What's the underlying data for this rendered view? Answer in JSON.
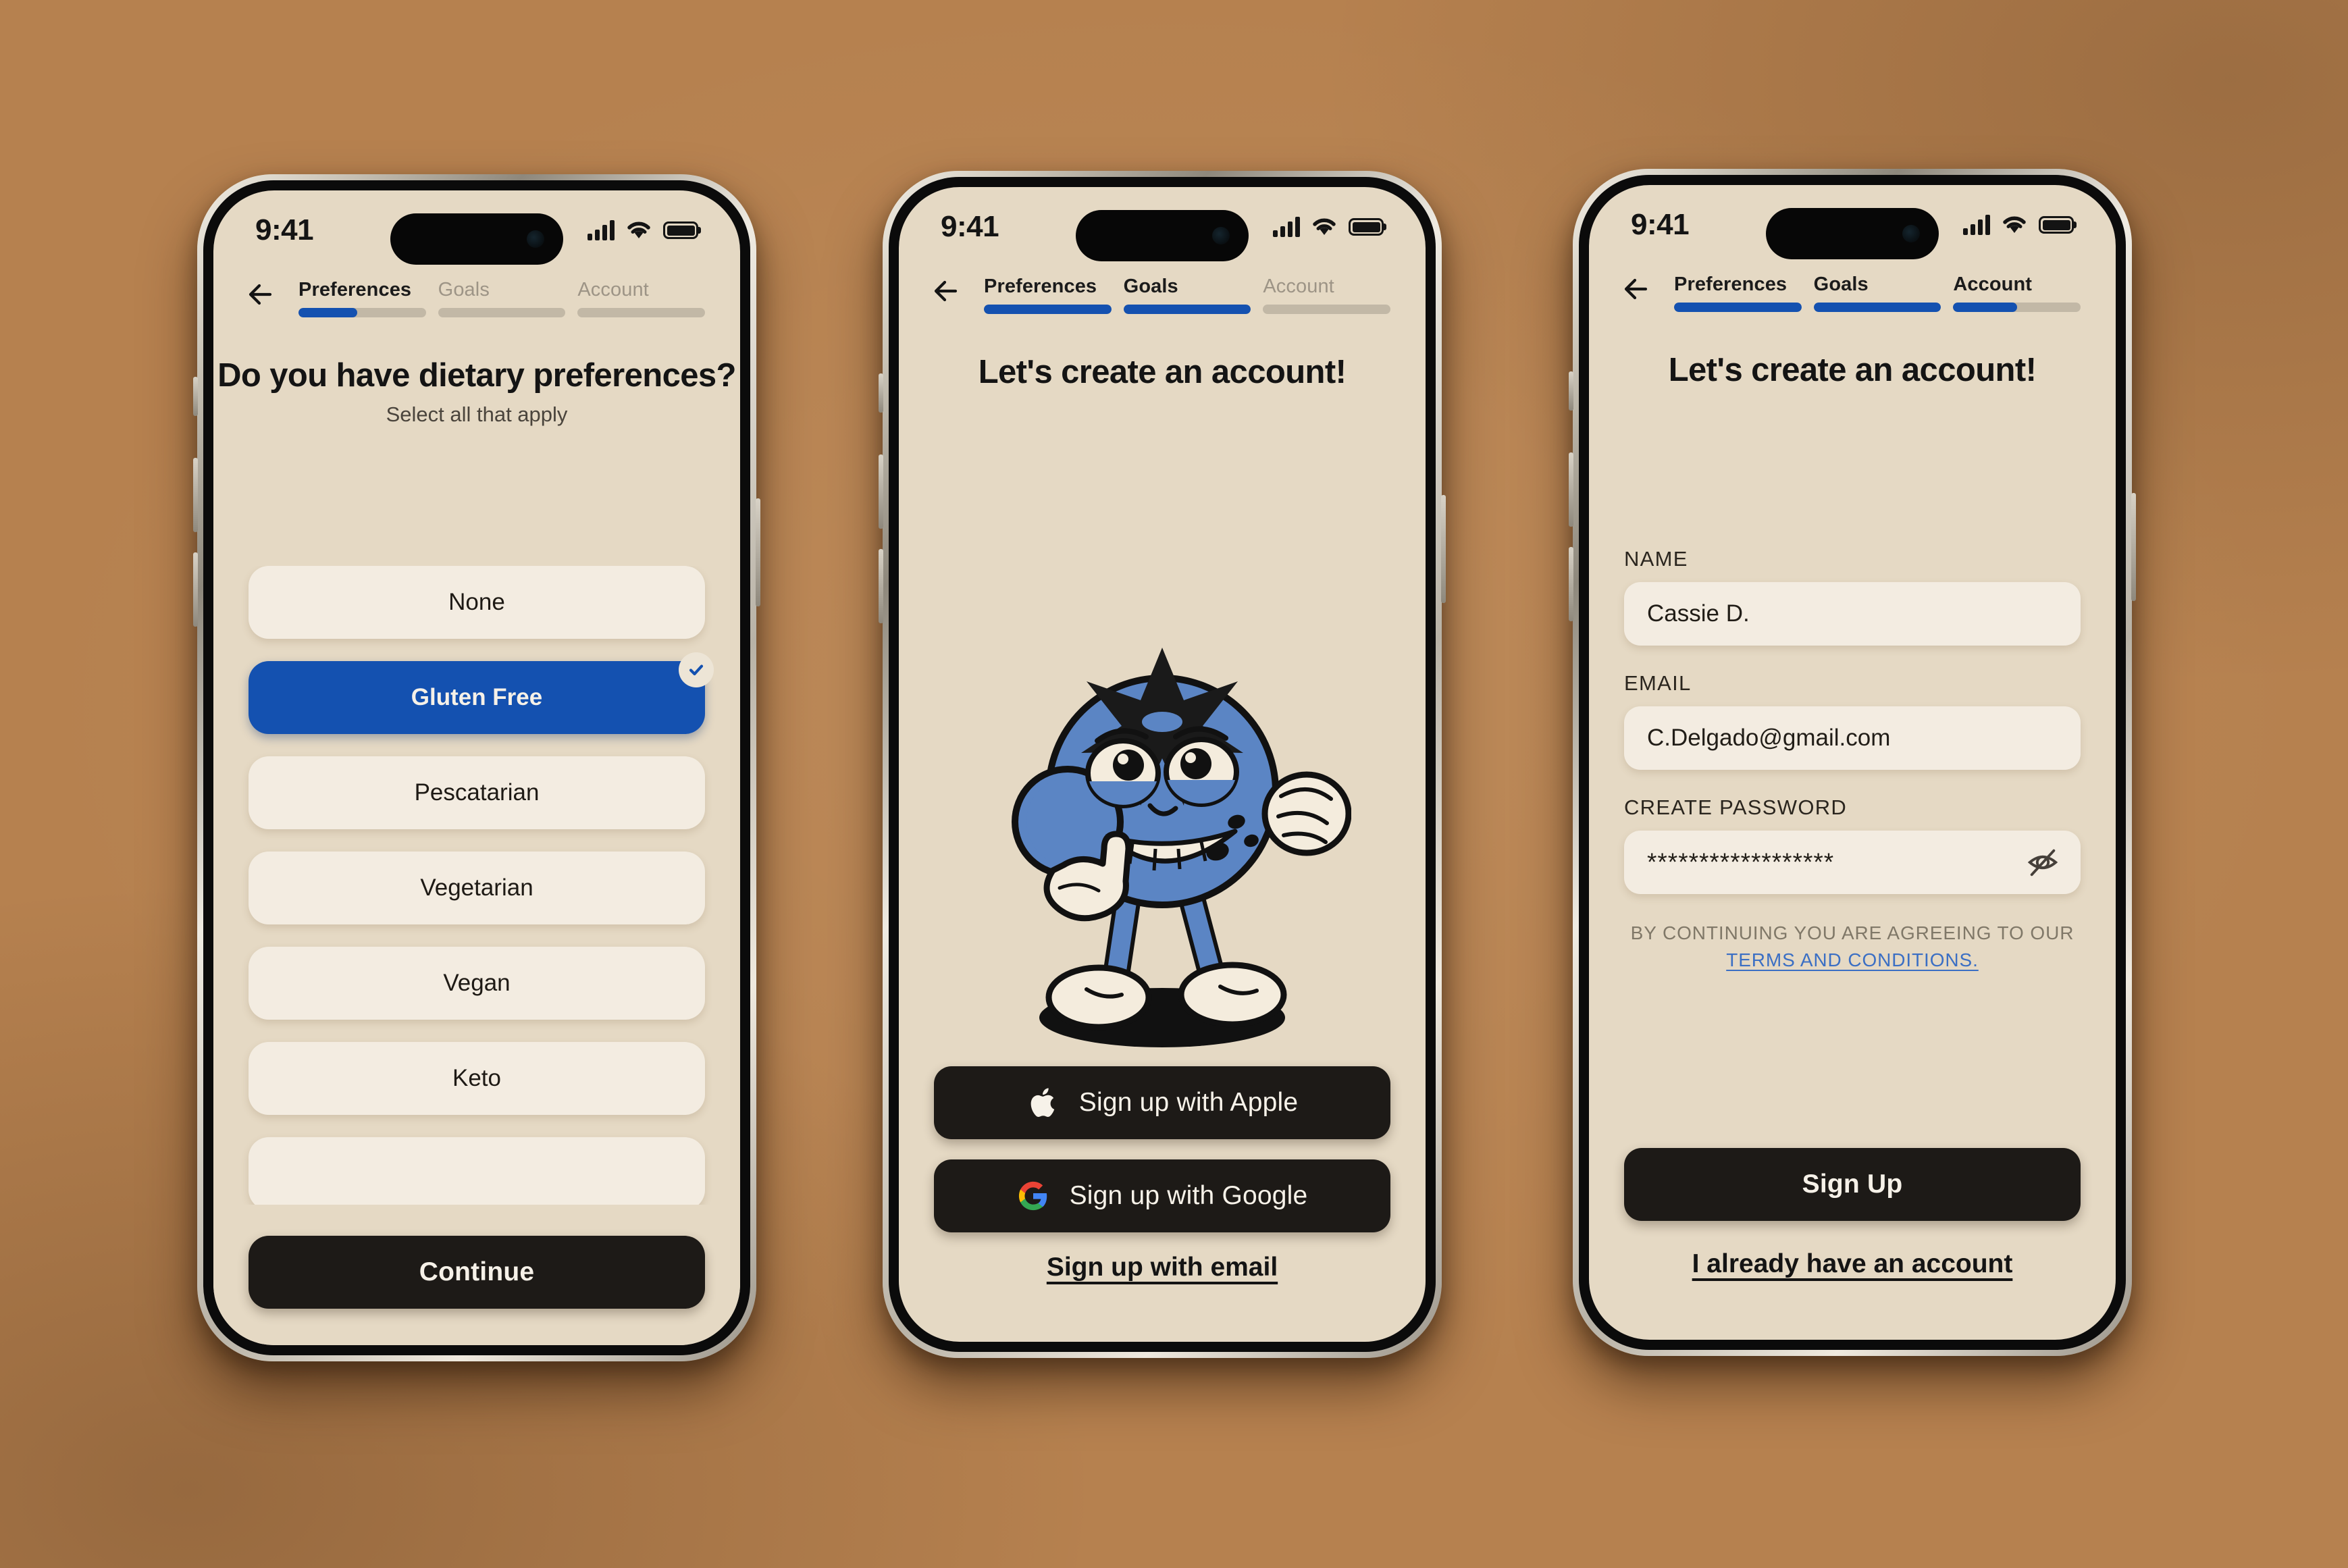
{
  "statusbar": {
    "time": "9:41",
    "signal_icon": "cellular-signal-icon",
    "wifi_icon": "wifi-icon",
    "battery_icon": "battery-full-icon"
  },
  "steps": {
    "preferences": "Preferences",
    "goals": "Goals",
    "account": "Account"
  },
  "colors": {
    "accent_blue": "#1451b0",
    "screen_bg": "#e5d9c4",
    "card_bg": "#f3ece1",
    "dark_button": "#1d1a17",
    "track_gray": "#c2b8a6",
    "link_blue": "#3b6fc4",
    "mascot_blue": "#5b85c4"
  },
  "phone1": {
    "title": "Do you have dietary preferences?",
    "subtitle": "Select all that apply",
    "progress": {
      "preferences": 46,
      "goals": 0,
      "account": 0
    },
    "options": [
      {
        "label": "None",
        "selected": false
      },
      {
        "label": "Gluten Free",
        "selected": true
      },
      {
        "label": "Pescatarian",
        "selected": false
      },
      {
        "label": "Vegetarian",
        "selected": false
      },
      {
        "label": "Vegan",
        "selected": false
      },
      {
        "label": "Keto",
        "selected": false
      }
    ],
    "continue_label": "Continue"
  },
  "phone2": {
    "title": "Let's create an account!",
    "progress": {
      "preferences": 100,
      "goals": 100,
      "account": 0
    },
    "mascot": "blueberry-mascot-illustration",
    "apple_label": "Sign up with Apple",
    "google_label": "Sign up with Google",
    "email_link": "Sign up with email"
  },
  "phone3": {
    "title": "Let's create an account!",
    "progress": {
      "preferences": 100,
      "goals": 100,
      "account": 50
    },
    "fields": {
      "name_label": "NAME",
      "name_value": "Cassie D.",
      "email_label": "EMAIL",
      "email_value": "C.Delgado@gmail.com",
      "password_label": "CREATE PASSWORD",
      "password_value": "******************",
      "password_toggle_icon": "eye-off-icon"
    },
    "terms_prefix": "BY CONTINUING YOU ARE AGREEING TO OUR ",
    "terms_link": "TERMS AND CONDITIONS.",
    "signup_label": "Sign Up",
    "login_link": "I already have an account"
  }
}
